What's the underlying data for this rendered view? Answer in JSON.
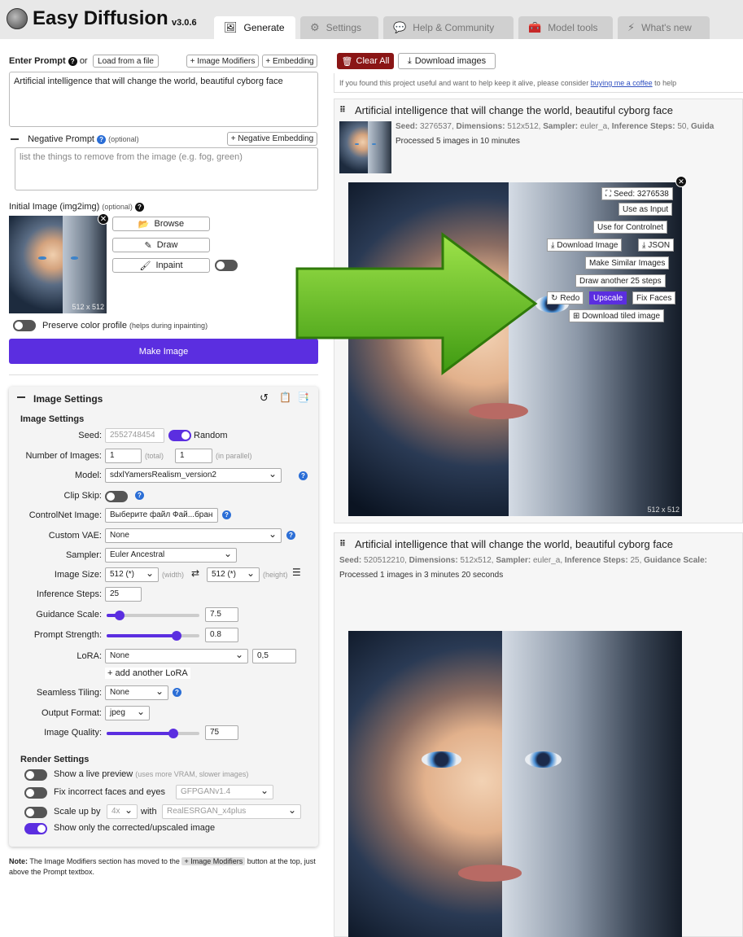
{
  "app": {
    "title": "Easy Diffusion",
    "version": "v3.0.6"
  },
  "tabs": [
    {
      "label": "Generate",
      "icon": "image-icon",
      "active": true
    },
    {
      "label": "Settings",
      "icon": "gear-icon"
    },
    {
      "label": "Help & Community",
      "icon": "comments-icon"
    },
    {
      "label": "Model tools",
      "icon": "toolbox-icon"
    },
    {
      "label": "What's new",
      "icon": "bolt-icon"
    }
  ],
  "prompt": {
    "label": "Enter Prompt",
    "or": "or",
    "load_file": "Load from a file",
    "image_modifiers": "+ Image Modifiers",
    "embedding": "+ Embedding",
    "value": "Artificial intelligence that will change the world, beautiful cyborg face"
  },
  "negative": {
    "label": "Negative Prompt",
    "optional": "(optional)",
    "embedding": "+ Negative Embedding",
    "placeholder": "list the things to remove from the image (e.g. fog, green)"
  },
  "init_image": {
    "label": "Initial Image (img2img)",
    "optional": "(optional)",
    "size": "512 x 512",
    "browse": "Browse",
    "draw": "Draw",
    "inpaint": "Inpaint"
  },
  "preserve": {
    "label": "Preserve color profile",
    "hint": "(helps during inpainting)"
  },
  "make_image": "Make Image",
  "image_settings": {
    "panel_title": "Image Settings",
    "section_title": "Image Settings",
    "seed_label": "Seed:",
    "seed_value": "2552748454",
    "random_label": "Random",
    "num_images_label": "Number of Images:",
    "num_total": "1",
    "total_hint": "(total)",
    "num_parallel": "1",
    "parallel_hint": "(in parallel)",
    "model_label": "Model:",
    "model_value": "sdxlYamersRealism_version2",
    "clip_skip_label": "Clip Skip:",
    "controlnet_label": "ControlNet Image:",
    "controlnet_value": "Выберите файл  Фай...бран",
    "vae_label": "Custom VAE:",
    "vae_value": "None",
    "sampler_label": "Sampler:",
    "sampler_value": "Euler Ancestral",
    "size_label": "Image Size:",
    "width_value": "512 (*)",
    "width_hint": "(width)",
    "height_value": "512 (*)",
    "height_hint": "(height)",
    "steps_label": "Inference Steps:",
    "steps_value": "25",
    "guidance_label": "Guidance Scale:",
    "guidance_value": "7.5",
    "guidance_level": 0.14,
    "strength_label": "Prompt Strength:",
    "strength_value": "0.8",
    "strength_level": 0.75,
    "lora_label": "LoRA:",
    "lora_value": "None",
    "lora_weight": "0,5",
    "add_lora": "+ add another LoRA",
    "tiling_label": "Seamless Tiling:",
    "tiling_value": "None",
    "format_label": "Output Format:",
    "format_value": "jpeg",
    "quality_label": "Image Quality:",
    "quality_value": "75",
    "quality_level": 0.72
  },
  "render": {
    "title": "Render Settings",
    "live_preview": "Show a live preview",
    "live_preview_hint": "(uses more VRAM, slower images)",
    "fix_faces": "Fix incorrect faces and eyes",
    "fix_faces_model": "GFPGANv1.4",
    "scale_up": "Scale up by",
    "scale_value": "4x",
    "with": "with",
    "upscaler": "RealESRGAN_x4plus",
    "show_only": "Show only the corrected/upscaled image"
  },
  "note": {
    "bold": "Note:",
    "text1": "The Image Modifiers section has moved to the",
    "chip": "+ Image Modifiers",
    "text2": "button at the top, just above the Prompt textbox."
  },
  "right": {
    "clear_all": "Clear All",
    "download_images": "Download images",
    "support_text": "If you found this project useful and want to help keep it alive, please consider",
    "support_link": "buying me a coffee",
    "support_tail": "to help"
  },
  "task1": {
    "title": "Artificial intelligence that will change the world, beautiful cyborg face",
    "seed_label": "Seed:",
    "seed": "3276537,",
    "dim_label": "Dimensions:",
    "dim": "512x512,",
    "sampler_label": "Sampler:",
    "sampler": "euler_a,",
    "steps_label": "Inference Steps:",
    "steps": "50,",
    "guid_label": "Guida",
    "processed": "Processed 5 images in 10 minutes",
    "overlay": {
      "seed": "Seed: 3276538",
      "use_input": "Use as Input",
      "use_controlnet": "Use for Controlnet",
      "download": "Download Image",
      "json": "JSON",
      "similar": "Make Similar Images",
      "draw_more": "Draw another 25 steps",
      "redo": "Redo",
      "upscale": "Upscale",
      "fix_faces": "Fix Faces",
      "tiled": "Download tiled image"
    },
    "size": "512 x 512"
  },
  "task2": {
    "title": "Artificial intelligence that will change the world, beautiful cyborg face",
    "seed_label": "Seed:",
    "seed": "520512210,",
    "dim_label": "Dimensions:",
    "dim": "512x512,",
    "sampler_label": "Sampler:",
    "sampler": "euler_a,",
    "steps_label": "Inference Steps:",
    "steps": "25,",
    "guid_label": "Guidance Scale:",
    "processed": "Processed 1 images in 3 minutes 20 seconds"
  }
}
